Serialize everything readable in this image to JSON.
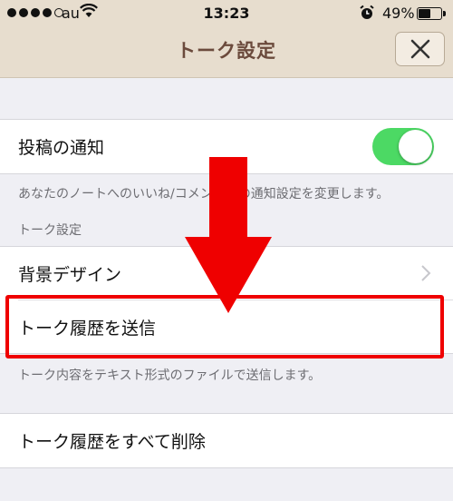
{
  "status_bar": {
    "carrier": "au",
    "time": "13:23",
    "battery": "49%",
    "battery_level": 0.49
  },
  "nav": {
    "title": "トーク設定",
    "close_icon": "close-x-icon"
  },
  "sections": {
    "notification": {
      "label": "投稿の通知",
      "toggle_on": true,
      "toggle_color": "#4cd964",
      "footnote": "あなたのノートへのいいね/コメントへの通知設定を変更します。"
    },
    "talk": {
      "header": "トーク設定",
      "background_label": "背景デザイン",
      "send_history_label": "トーク履歴を送信",
      "footnote": "トーク内容をテキスト形式のファイルで送信します。"
    },
    "delete": {
      "label": "トーク履歴をすべて削除"
    }
  },
  "annotation": {
    "color": "#ef0000",
    "icon": "down-arrow-icon"
  }
}
